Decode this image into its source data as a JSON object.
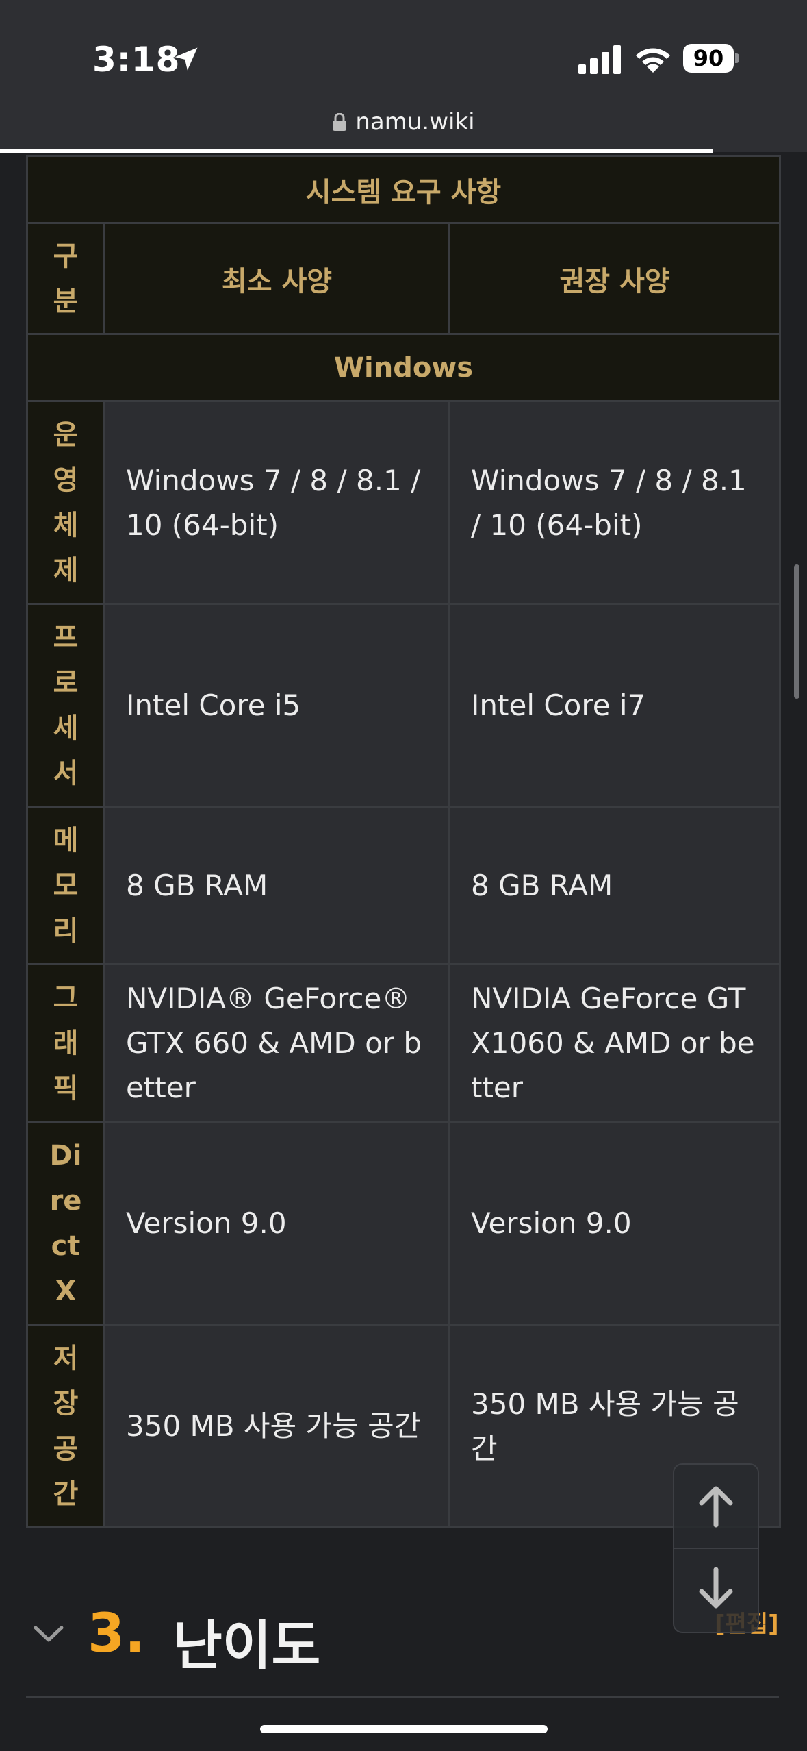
{
  "status": {
    "time": "3:18",
    "battery": "90"
  },
  "browser": {
    "url": "namu.wiki"
  },
  "table": {
    "title": "시스템 요구 사항",
    "col_label": [
      "구",
      "분"
    ],
    "min_header": "최소 사양",
    "rec_header": "권장 사양",
    "platform": "Windows",
    "rows": [
      {
        "label": [
          "운",
          "영",
          "체",
          "제"
        ],
        "min": "Windows 7 / 8 / 8.1 / 10 (64-bit)",
        "rec": "Windows 7 / 8 / 8.1 / 10 (64-bit)"
      },
      {
        "label": [
          "프",
          "로",
          "세",
          "서"
        ],
        "min": "Intel Core i5",
        "rec": "Intel Core i7"
      },
      {
        "label": [
          "메",
          "모",
          "리"
        ],
        "min": "8 GB RAM",
        "rec": "8 GB RAM"
      },
      {
        "label": [
          "그",
          "래",
          "픽"
        ],
        "min": "NVIDIA® GeForce® GTX 660 & AMD or better",
        "rec": "NVIDIA GeForce GTX1060 & AMD or better"
      },
      {
        "label": [
          "Di",
          "re",
          "ct",
          "X"
        ],
        "min": "Version 9.0",
        "rec": "Version 9.0"
      },
      {
        "label": [
          "저",
          "장",
          "공",
          "간"
        ],
        "min": "350 MB 사용 가능 공간",
        "rec": "350 MB 사용 가능 공간"
      }
    ]
  },
  "section": {
    "number": "3.",
    "title": "난이도",
    "edit": "[편집]"
  },
  "icons": [
    "location-arrow-icon",
    "signal-icon",
    "wifi-icon",
    "battery-icon",
    "lock-icon",
    "chevron-down-icon",
    "arrow-up-icon",
    "arrow-down-icon"
  ]
}
